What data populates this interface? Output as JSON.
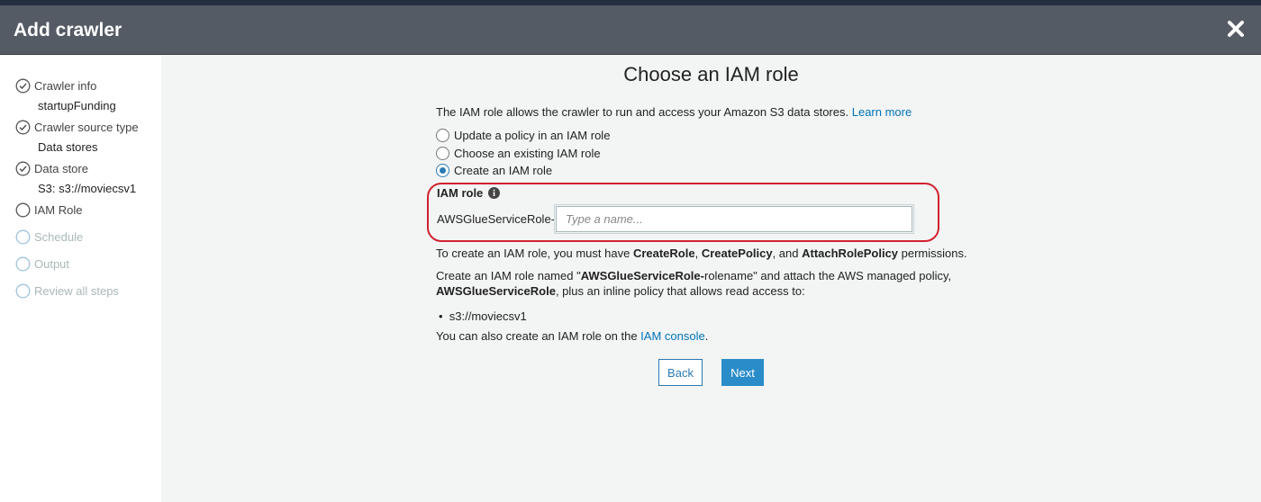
{
  "header": {
    "title": "Add crawler"
  },
  "icons": {
    "close": "close-icon",
    "completed_step": "check-circle-icon",
    "pending_step": "circle-icon",
    "info": "info-icon"
  },
  "colors": {
    "accent": "#2a7ab5",
    "link": "#0073bb",
    "highlight": "#d0212f",
    "header_bg": "#545b64"
  },
  "sidebar": {
    "steps": [
      {
        "label": "Crawler info",
        "value": "startupFunding",
        "state": "completed"
      },
      {
        "label": "Crawler source type",
        "value": "Data stores",
        "state": "completed"
      },
      {
        "label": "Data store",
        "value": "S3: s3://moviecsv1",
        "state": "completed"
      },
      {
        "label": "IAM Role",
        "state": "current"
      },
      {
        "label": "Schedule",
        "state": "disabled"
      },
      {
        "label": "Output",
        "state": "disabled"
      },
      {
        "label": "Review all steps",
        "state": "disabled"
      }
    ]
  },
  "main": {
    "heading": "Choose an IAM role",
    "intro": "The IAM role allows the crawler to run and access your Amazon S3 data stores.",
    "learn_more": "Learn more",
    "options": [
      {
        "label": "Update a policy in an IAM role",
        "checked": false
      },
      {
        "label": "Choose an existing IAM role",
        "checked": false
      },
      {
        "label": "Create an IAM role",
        "checked": true
      }
    ],
    "iam_role_label": "IAM role",
    "role_prefix": "AWSGlueServiceRole-",
    "role_input": {
      "value": "",
      "placeholder": "Type a name..."
    },
    "permissions": {
      "text1": "To create an IAM role, you must have ",
      "p1": "CreateRole",
      "sep1": ", ",
      "p2": "CreatePolicy",
      "sep2": ", and ",
      "p3": "AttachRolePolicy",
      "text2": " permissions."
    },
    "create_desc": {
      "t1": "Create an IAM role named \"",
      "b1": "AWSGlueServiceRole-",
      "t2": "rolename\" and attach the AWS managed policy,",
      "b2": "AWSGlueServiceRole",
      "t3": ", plus an inline policy that allows read access to:"
    },
    "access_path": "s3://moviecsv1",
    "console_text": "You can also create an IAM role on the ",
    "console_link": "IAM console",
    "console_end": "."
  },
  "buttons": {
    "back": "Back",
    "next": "Next"
  }
}
